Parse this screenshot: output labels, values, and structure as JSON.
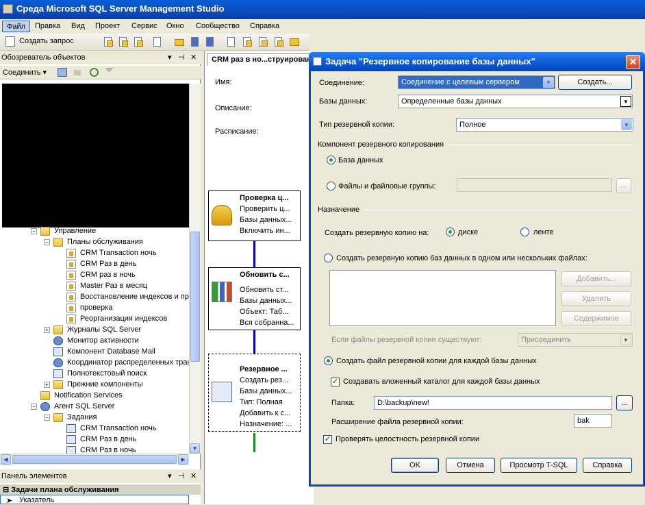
{
  "app": {
    "title": "Среда Microsoft SQL Server Management Studio"
  },
  "menu": [
    "Файл",
    "Правка",
    "Вид",
    "Проект",
    "Сервис",
    "Окно",
    "Сообщество",
    "Справка"
  ],
  "toolbar": {
    "new_query": "Создать запрос"
  },
  "object_explorer": {
    "title": "Обозреватель объектов",
    "connect": "Соединить ▾",
    "tree": [
      {
        "label": "Управление",
        "icon": "folder",
        "indent": 1,
        "expand": "−"
      },
      {
        "label": "Планы обслуживания",
        "icon": "folder",
        "indent": 2,
        "expand": "−"
      },
      {
        "label": "CRM Transaction ночь",
        "icon": "plan",
        "indent": 3
      },
      {
        "label": "CRM Раз в день",
        "icon": "plan",
        "indent": 3
      },
      {
        "label": "CRM раз в ночь",
        "icon": "plan",
        "indent": 3
      },
      {
        "label": "Master Раз в месяц",
        "icon": "plan",
        "indent": 3
      },
      {
        "label": "Восстановление индексов и провер",
        "icon": "plan",
        "indent": 3
      },
      {
        "label": "проверка",
        "icon": "plan",
        "indent": 3
      },
      {
        "label": "Реорганизация индексов",
        "icon": "plan",
        "indent": 3
      },
      {
        "label": "Журналы SQL Server",
        "icon": "folder",
        "indent": 2,
        "expand": "+"
      },
      {
        "label": "Монитор активности",
        "icon": "gear",
        "indent": 2
      },
      {
        "label": "Компонент Database Mail",
        "icon": "job",
        "indent": 2
      },
      {
        "label": "Координатор распределенных транза",
        "icon": "gear",
        "indent": 2
      },
      {
        "label": "Полнотекстовый поиск",
        "icon": "job",
        "indent": 2
      },
      {
        "label": "Прежние компоненты",
        "icon": "folder",
        "indent": 2,
        "expand": "+"
      },
      {
        "label": "Notification Services",
        "icon": "folder",
        "indent": 1
      },
      {
        "label": "Агент SQL Server",
        "icon": "gear",
        "indent": 1,
        "expand": "−"
      },
      {
        "label": "Задания",
        "icon": "folder",
        "indent": 2,
        "expand": "−"
      },
      {
        "label": "CRM Transaction ночь",
        "icon": "job",
        "indent": 3
      },
      {
        "label": "CRM Раз в день",
        "icon": "job",
        "indent": 3
      },
      {
        "label": "CRM Раз в ночь",
        "icon": "job",
        "indent": 3
      }
    ]
  },
  "toolbox": {
    "title": "Панель элементов",
    "section": "Задачи плана обслуживания",
    "item": "Указатель"
  },
  "designer": {
    "tab": "CRM раз в но...струирование",
    "name_label": "Имя:",
    "description_label": "Описание:",
    "schedule_label": "Расписание:",
    "tasks": [
      {
        "title": "Проверка ц...",
        "lines": [
          "Проверить ц...",
          "Базы данных...",
          "Включить ин..."
        ]
      },
      {
        "title": "Обновить с...",
        "lines": [
          "Обновить ст...",
          "Базы данных...",
          "Объект: Таб...",
          "Вся собранна..."
        ]
      },
      {
        "title": "Резервное ...",
        "lines": [
          "Создать рез...",
          "Базы данных...",
          "Тип: Полная",
          "Добавить к с...",
          "Назначение: ..."
        ]
      }
    ]
  },
  "dialog": {
    "title": "Задача \"Резервное копирование базы данных\"",
    "connection_label": "Соединение:",
    "connection_value": "Соединение с целевым сервером",
    "create_button": "Создать...",
    "databases_label": "Базы данных:",
    "databases_value": "Определенные базы данных",
    "backup_type_label": "Тип резервной копии:",
    "backup_type_value": "Полное",
    "component_group": "Компонент резервного копирования",
    "radio_database": "База данных",
    "radio_files": "Файлы и файловые группы:",
    "ellipsis": "...",
    "destination_group": "Назначение",
    "backup_to_label": "Создать резервную копию на:",
    "radio_disk": "диске",
    "radio_tape": "ленте",
    "radio_multiple_files": "Создать резервную копию баз данных в одном или нескольких файлах:",
    "add_button": "Добавить...",
    "remove_button": "Удалить",
    "contents_button": "Содержимое",
    "if_exists_label": "Если файлы резервной копии существуют:",
    "if_exists_value": "Присоединить",
    "radio_per_db": "Создать файл резервной копии для каждой базы данных",
    "subdir_check": "Создавать вложенный каталог для каждой базы данных",
    "folder_label": "Папка:",
    "folder_value": "D:\\backup\\new!",
    "extension_label": "Расширение файла резервной копии:",
    "extension_value": "bak",
    "verify_check": "Проверять целостность резервной копии",
    "ok": "OK",
    "cancel": "Отмена",
    "view_tsql": "Просмотр T-SQL",
    "help": "Справка"
  }
}
